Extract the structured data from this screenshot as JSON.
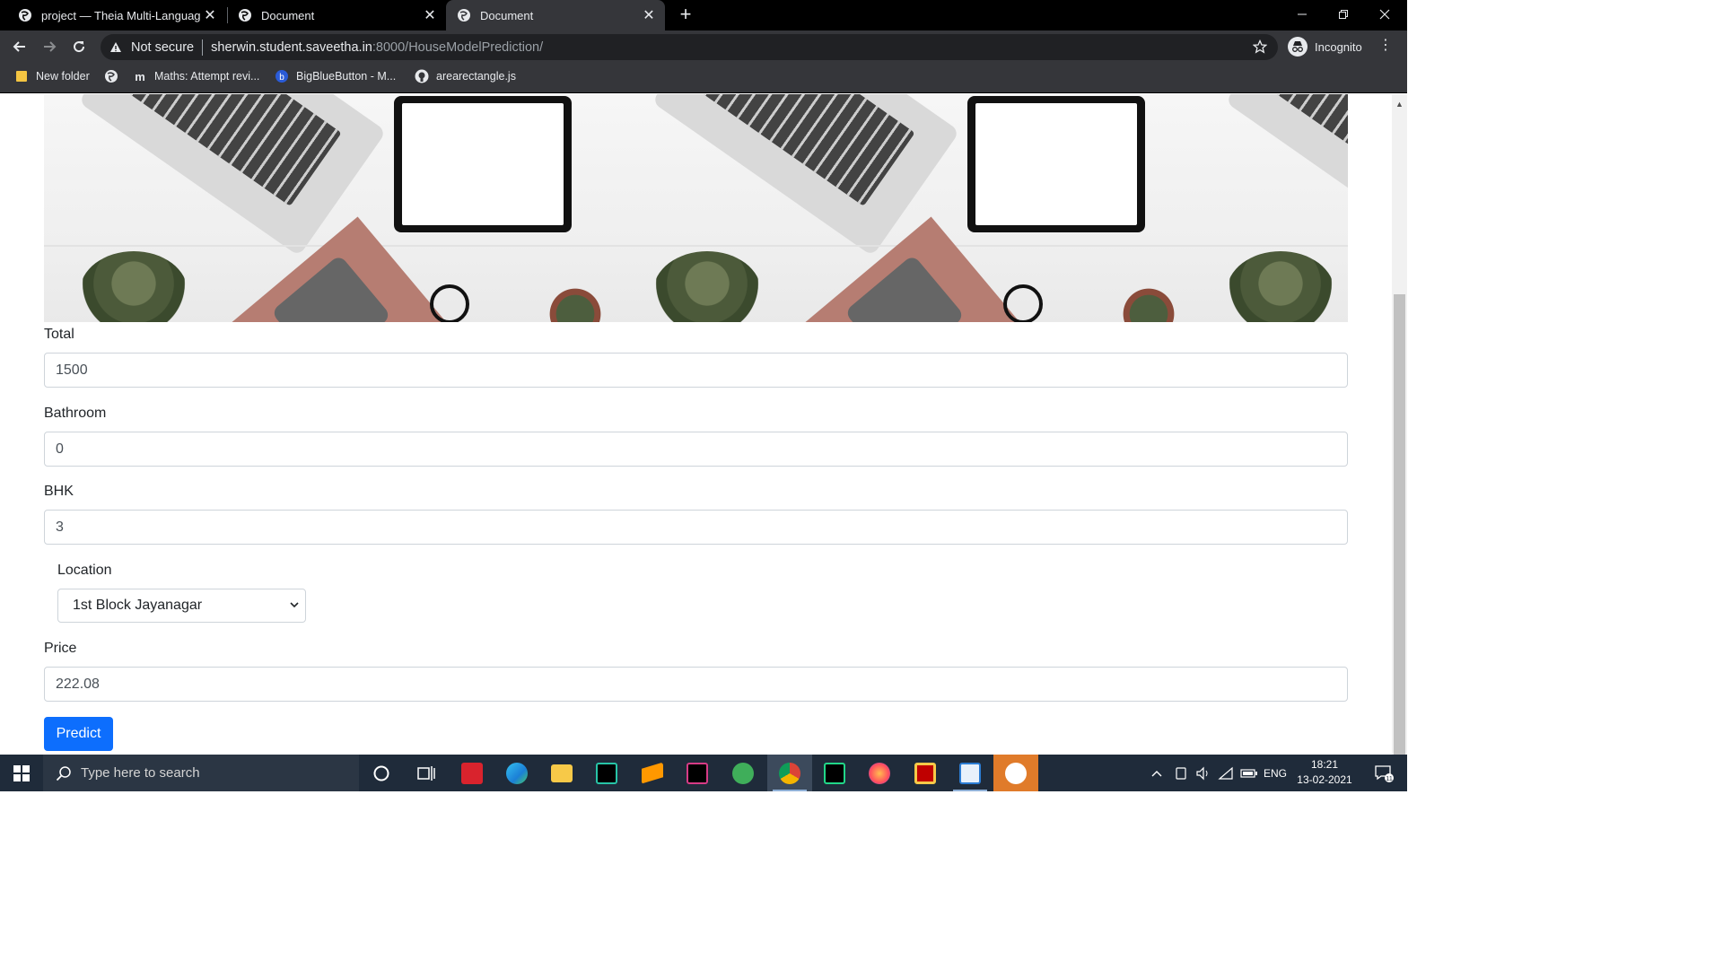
{
  "browser": {
    "tabs": [
      {
        "title": "project — Theia Multi-Language",
        "active": false
      },
      {
        "title": "Document",
        "active": false
      },
      {
        "title": "Document",
        "active": true
      }
    ],
    "address": {
      "security_label": "Not secure",
      "host": "sherwin.student.saveetha.in",
      "path": ":8000/HouseModelPrediction/"
    },
    "profile_label": "Incognito",
    "bookmarks": [
      {
        "label": "New folder",
        "icon": "folder-icon"
      },
      {
        "label": "",
        "icon": "globe-icon"
      },
      {
        "label": "Maths: Attempt revi...",
        "icon": "moodle-icon"
      },
      {
        "label": "BigBlueButton - M...",
        "icon": "bigbluebutton-icon"
      },
      {
        "label": "arearectangle.js",
        "icon": "github-icon"
      }
    ]
  },
  "form": {
    "total": {
      "label": "Total",
      "value": "1500"
    },
    "bathroom": {
      "label": "Bathroom",
      "value": "0"
    },
    "bhk": {
      "label": "BHK",
      "value": "3"
    },
    "location": {
      "label": "Location",
      "selected": "1st Block Jayanagar"
    },
    "price": {
      "label": "Price",
      "value": "222.08"
    },
    "submit_label": "Predict"
  },
  "taskbar": {
    "search_placeholder": "Type here to search",
    "language": "ENG",
    "time": "18:21",
    "date": "13-02-2021",
    "notification_count": "11",
    "apps": [
      "cortana-icon",
      "task-view-icon",
      "pdf-x-icon",
      "edge-icon",
      "file-explorer-icon",
      "jetbrains-toolbox-icon",
      "sublime-text-icon",
      "terminal-icon",
      "app-icon",
      "chrome-icon",
      "pycharm-icon",
      "firefox-icon",
      "filezilla-icon",
      "notepad-icon",
      "screen-recorder-icon"
    ]
  },
  "colors": {
    "primary_button": "#0d6efd",
    "tabbar": "#000000",
    "toolbar": "#35363a",
    "taskbar": "#1f2b3a"
  }
}
